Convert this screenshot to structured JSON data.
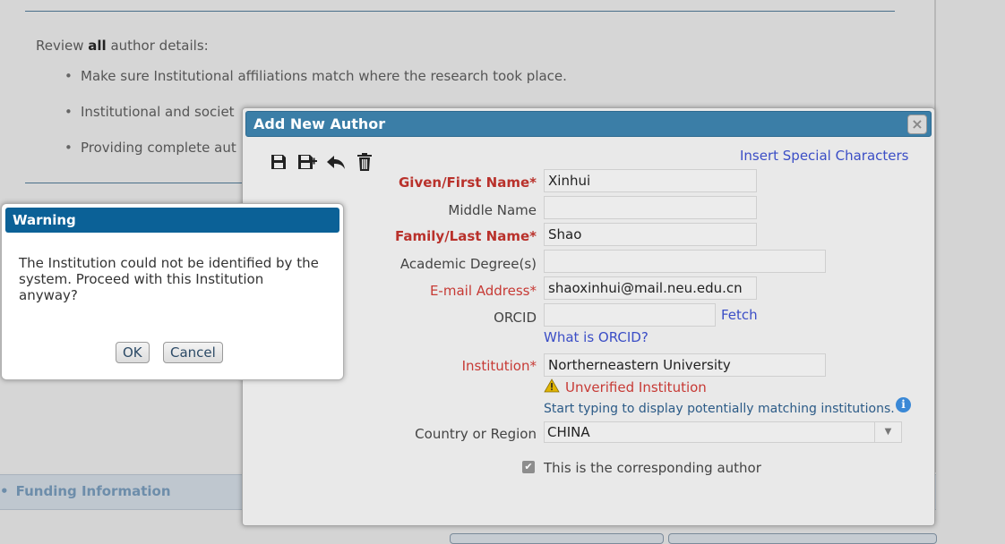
{
  "background": {
    "review_prefix": "Review ",
    "review_bold": "all",
    "review_suffix": " author details:",
    "bullets": [
      "Make sure Institutional affiliations match where the research took place.",
      "Institutional and societ",
      "Providing complete aut"
    ],
    "funding_label": "Funding Information"
  },
  "dialog": {
    "title": "Add New Author",
    "close_icon": "close-icon",
    "special_chars_link": "Insert Special Characters",
    "toolbar": [
      "save-icon",
      "save-and-add-icon",
      "undo-icon",
      "delete-icon"
    ],
    "fields": {
      "given_label": "Given/First Name*",
      "given_value": "Xinhui",
      "middle_label": "Middle Name",
      "middle_value": "",
      "family_label": "Family/Last Name*",
      "family_value": "Shao",
      "degree_label": "Academic Degree(s)",
      "degree_value": "",
      "email_label": "E-mail Address*",
      "email_value": "shaoxinhui@mail.neu.edu.cn",
      "orcid_label": "ORCID",
      "orcid_value": "",
      "fetch_link": "Fetch",
      "orcid_help_link": "What is ORCID?",
      "institution_label": "Institution*",
      "institution_value": "Northerneastern University",
      "unverified_text": "Unverified Institution",
      "institution_hint": "Start typing to display potentially matching institutions.",
      "country_label": "Country or Region",
      "country_value": "CHINA",
      "corresponding_label": "This is the corresponding author",
      "corresponding_checked": true
    }
  },
  "warning": {
    "title": "Warning",
    "message": "The Institution could not be identified by the system. Proceed with this Institution anyway?",
    "ok_label": "OK",
    "cancel_label": "Cancel"
  }
}
